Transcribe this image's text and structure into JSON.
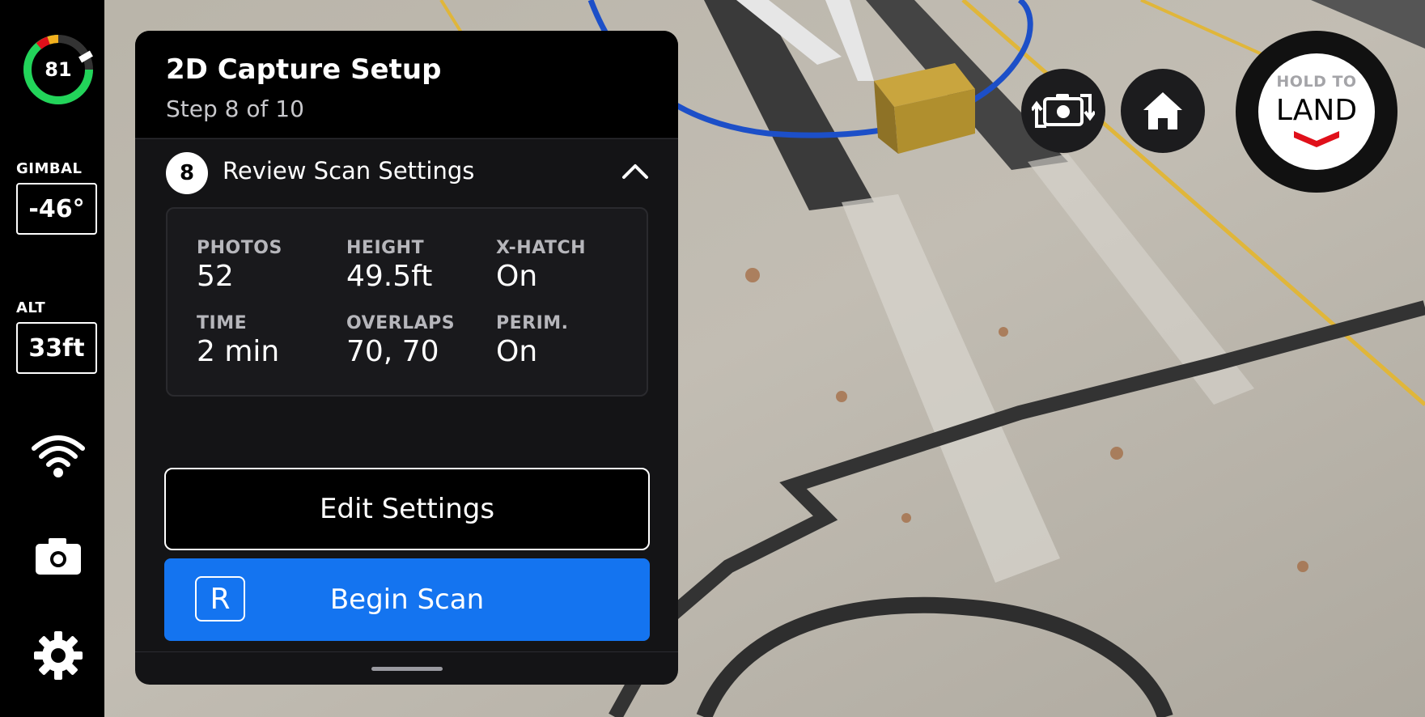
{
  "status": {
    "battery_percent": "81",
    "gimbal_label": "GIMBAL",
    "gimbal_value": "-46°",
    "alt_label": "ALT",
    "alt_value": "33ft"
  },
  "rail_icons": [
    "wifi-icon",
    "camera-icon",
    "gear-icon"
  ],
  "panel": {
    "title": "2D Capture Setup",
    "subtitle": "Step 8 of 10",
    "step": {
      "number": "8",
      "title": "Review Scan Settings"
    },
    "stats": [
      {
        "label": "PHOTOS",
        "value": "52"
      },
      {
        "label": "HEIGHT",
        "value": "49.5ft"
      },
      {
        "label": "X-HATCH",
        "value": "On"
      },
      {
        "label": "TIME",
        "value": "2 min"
      },
      {
        "label": "OVERLAPS",
        "value": "70, 70"
      },
      {
        "label": "PERIM.",
        "value": "On"
      }
    ],
    "edit_button": "Edit Settings",
    "begin_button": "Begin Scan",
    "begin_shortcut": "R"
  },
  "controls": {
    "camera_switch_icon": "camera-switch-icon",
    "home_icon": "home-icon",
    "land_hold": "HOLD TO",
    "land_label": "LAND"
  },
  "colors": {
    "accent": "#1474f0",
    "battery_green": "#22d45a",
    "land_red": "#e0101a"
  }
}
